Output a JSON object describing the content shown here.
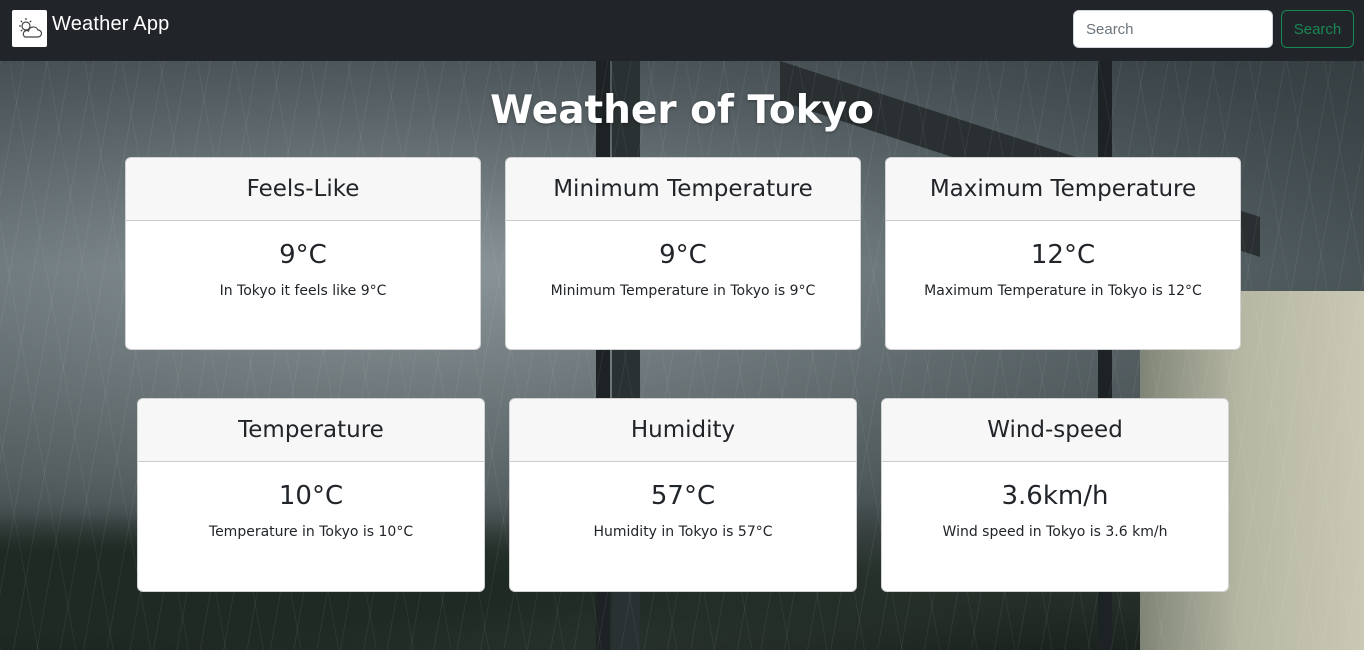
{
  "navbar": {
    "brand": "Weather App",
    "logo_icon": "cloud-sun-icon",
    "search_placeholder": "Search",
    "search_button": "Search"
  },
  "page": {
    "title": "Weather of Tokyo"
  },
  "colors": {
    "navbar_bg": "#212529",
    "search_button": "#198754"
  },
  "cards": [
    {
      "title": "Feels-Like",
      "value": "9°C",
      "text": "In Tokyo it feels like 9°C"
    },
    {
      "title": "Minimum Temperature",
      "value": "9°C",
      "text": "Minimum Temperature in Tokyo is 9°C"
    },
    {
      "title": "Maximum Temperature",
      "value": "12°C",
      "text": "Maximum Temperature in Tokyo is 12°C"
    },
    {
      "title": "Temperature",
      "value": "10°C",
      "text": "Temperature in Tokyo is 10°C"
    },
    {
      "title": "Humidity",
      "value": "57°C",
      "text": "Humidity in Tokyo is 57°C"
    },
    {
      "title": "Wind-speed",
      "value": "3.6km/h",
      "text": "Wind speed in Tokyo is 3.6 km/h"
    }
  ]
}
